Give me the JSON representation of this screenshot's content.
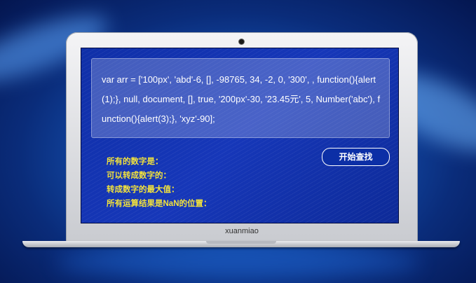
{
  "code": {
    "text": "var arr = ['100px', 'abd'-6, [], -98765, 34, -2, 0, '300', , function(){alert(1);}, null, document, [], true, '200px'-30, '23.45元', 5, Number('abc'), function(){alert(3);}, 'xyz'-90];"
  },
  "button": {
    "label": "开始查找"
  },
  "results": [
    "所有的数字是：",
    "可以转成数字的：",
    "转成数字的最大值：",
    "所有运算结果是NaN的位置："
  ],
  "laptop": {
    "brand": "xuanmiao"
  },
  "colors": {
    "screen_bg": "#1637b9",
    "result_text": "#f2e23c",
    "code_text": "#ffffff"
  }
}
